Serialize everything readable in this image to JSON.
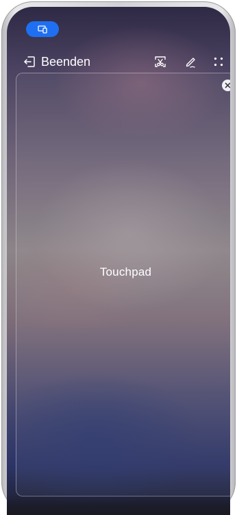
{
  "status_bar": {
    "cast_indicator_icon": "screen-cast-icon",
    "accent_color": "#1f6ff2"
  },
  "toolbar": {
    "exit_label": "Beenden",
    "exit_icon": "exit-door-icon",
    "screenshot_icon": "screenshot-scissors-icon",
    "annotate_icon": "pen-annotate-icon",
    "more_icon": "more-dots-icon"
  },
  "touchpad": {
    "label": "Touchpad",
    "close_icon": "close-icon"
  }
}
